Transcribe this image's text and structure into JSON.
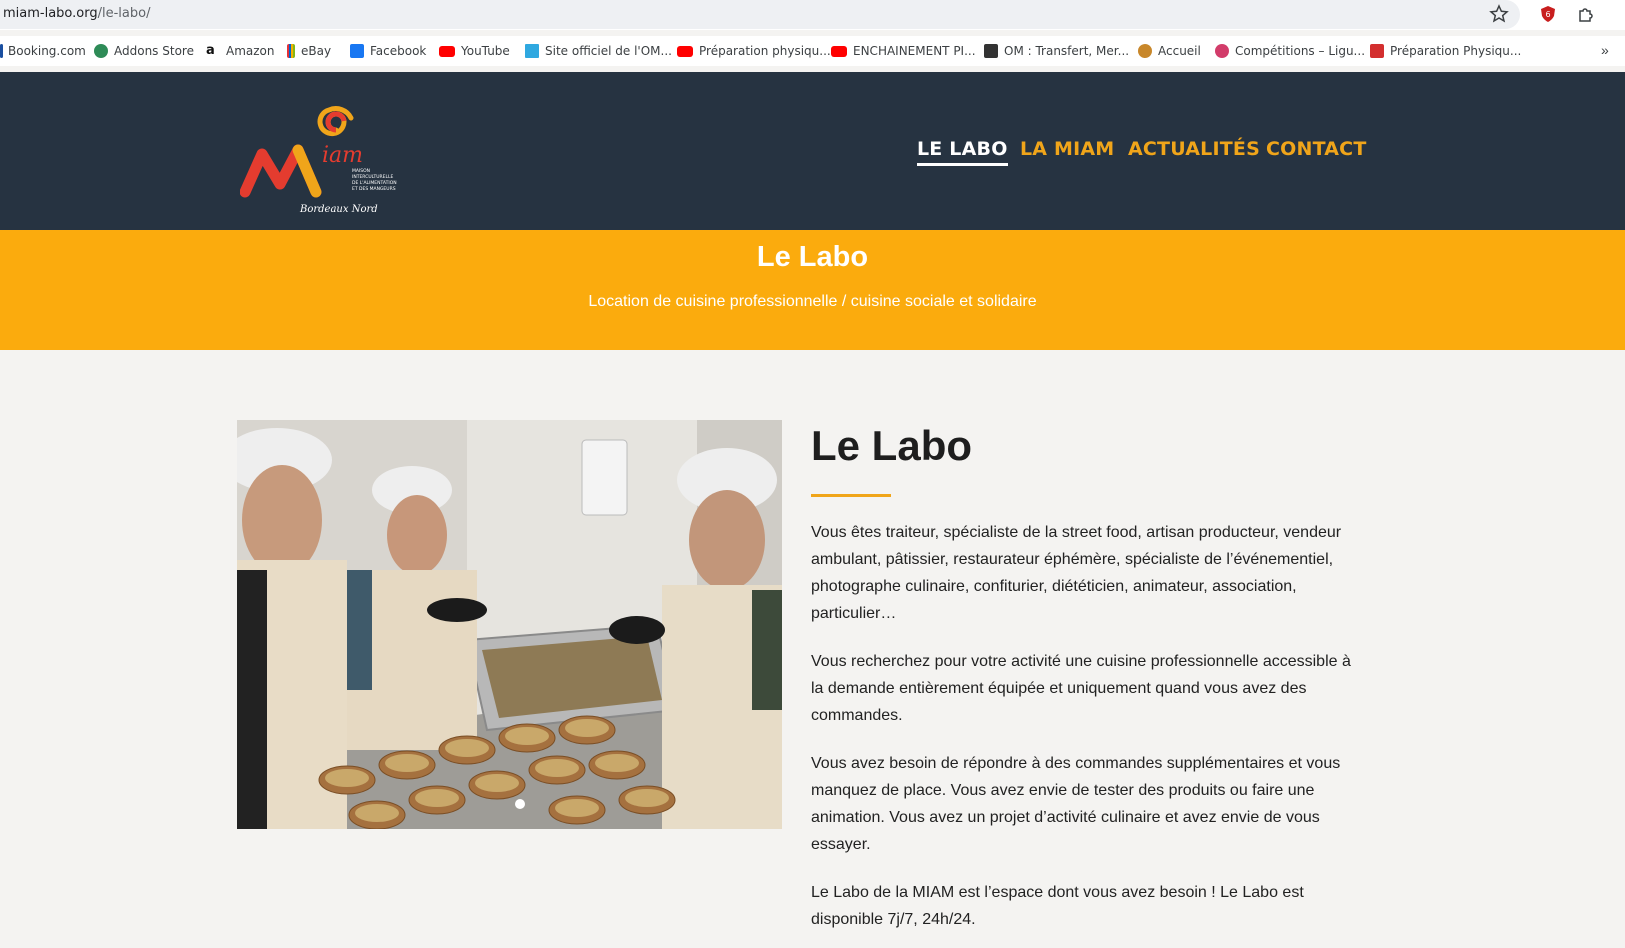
{
  "browser": {
    "url_domain": "miam-labo.org",
    "url_path": "/le-labo/",
    "bookmarks": [
      {
        "label": "Booking.com",
        "icon": "booking-icon"
      },
      {
        "label": "Addons Store",
        "icon": "addons-icon"
      },
      {
        "label": "Amazon",
        "icon": "amazon-icon"
      },
      {
        "label": "eBay",
        "icon": "ebay-icon"
      },
      {
        "label": "Facebook",
        "icon": "facebook-icon"
      },
      {
        "label": "YouTube",
        "icon": "youtube-icon"
      },
      {
        "label": "Site officiel de l'OM...",
        "icon": "om-icon"
      },
      {
        "label": "Préparation physiqu...",
        "icon": "youtube-icon"
      },
      {
        "label": "ENCHAINEMENT PI...",
        "icon": "youtube-icon"
      },
      {
        "label": "OM : Transfert, Mer...",
        "icon": "news-icon"
      },
      {
        "label": "Accueil",
        "icon": "home-icon"
      },
      {
        "label": "Compétitions – Ligu...",
        "icon": "league-icon"
      },
      {
        "label": "Préparation Physiqu...",
        "icon": "runner-icon"
      }
    ],
    "more_label": "»"
  },
  "header": {
    "logo_alt": "MIAM - Maison Interculturelle de l'Alimentation et des Mangeurs",
    "nav": [
      {
        "label": "LE LABO",
        "active": true
      },
      {
        "label": "LA MIAM",
        "active": false
      },
      {
        "label": "ACTUALITÉS",
        "active": false
      },
      {
        "label": "CONTACT",
        "active": false
      }
    ]
  },
  "banner": {
    "title": "Le Labo",
    "subtitle": "Location de cuisine professionnelle / cuisine sociale et solidaire"
  },
  "main": {
    "title": "Le Labo",
    "paragraphs": [
      "Vous êtes traiteur, spécialiste de la street food, artisan producteur, vendeur ambulant, pâtissier, restaurateur éphémère, spécialiste de l’événementiel, photographe culinaire, confiturier, diététicien, animateur, association, particulier…",
      "Vous recherchez pour votre activité une cuisine professionnelle accessible à la demande entièrement équipée et uniquement quand vous avez des commandes.",
      "Vous avez besoin de répondre à des commandes supplémentaires et vous manquez de place. Vous avez envie de tester des produits ou faire une animation. Vous avez un projet d’activité culinaire et avez envie de vous essayer.",
      "Le Labo de la MIAM est l’espace dont vous avez besoin ! Le Labo est disponible 7j/7, 24h/24."
    ]
  },
  "colors": {
    "header_bg": "#263341",
    "accent": "#f0a51a",
    "banner_bg": "#fbab0d",
    "page_bg": "#f4f3f1"
  }
}
